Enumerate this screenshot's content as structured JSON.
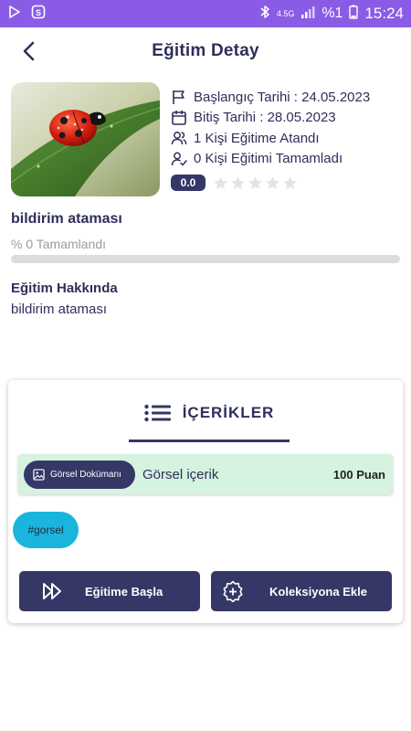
{
  "status_bar": {
    "network": "4.5G",
    "battery": "%1",
    "time": "15:24"
  },
  "header": {
    "title": "Eğitim Detay"
  },
  "training": {
    "start_date": "Başlangıç Tarihi : 24.05.2023",
    "end_date": "Bitiş Tarihi : 28.05.2023",
    "assigned": "1 Kişi Eğitime Atandı",
    "completed": "0 Kişi Eğitimi Tamamladı",
    "rating": "0.0",
    "stars_filled": 0,
    "stars_total": 5,
    "title": "bildirim ataması",
    "progress_text": "% 0 Tamamlandı",
    "progress_value": 0
  },
  "about": {
    "title": "Eğitim Hakkında",
    "text": "bildirim ataması"
  },
  "contents": {
    "tab_label": "İÇERİKLER",
    "items": [
      {
        "type_label": "Görsel Dokümanı",
        "name": "Görsel içerik",
        "points": "100 Puan"
      }
    ],
    "tag": "#gorsel"
  },
  "actions": {
    "start_label": "Eğitime Başla",
    "collection_label": "Koleksiyona Ekle"
  },
  "colors": {
    "status_bar": "#8a5ce6",
    "primary": "#353766",
    "content_bg": "#d5f3df",
    "tag_bg": "#1ab5dc"
  }
}
